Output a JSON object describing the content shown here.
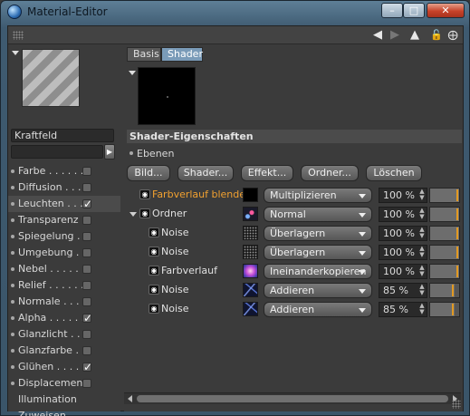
{
  "window": {
    "title": "Material-Editor"
  },
  "left": {
    "material_name": "Kraftfeld",
    "channels": [
      {
        "label": "Farbe . . . . . .",
        "checked": false,
        "has_checkbox": true
      },
      {
        "label": "Diffusion . . . .",
        "checked": false,
        "has_checkbox": true
      },
      {
        "label": "Leuchten . . . .",
        "checked": true,
        "has_checkbox": true,
        "active": true
      },
      {
        "label": "Transparenz",
        "checked": false,
        "has_checkbox": true
      },
      {
        "label": "Spiegelung . .",
        "checked": false,
        "has_checkbox": true
      },
      {
        "label": "Umgebung . .",
        "checked": false,
        "has_checkbox": true
      },
      {
        "label": "Nebel . . . . . .",
        "checked": false,
        "has_checkbox": true
      },
      {
        "label": "Relief . . . . . .",
        "checked": false,
        "has_checkbox": true
      },
      {
        "label": "Normale . . . .",
        "checked": false,
        "has_checkbox": true
      },
      {
        "label": "Alpha . . . . . .",
        "checked": true,
        "has_checkbox": true
      },
      {
        "label": "Glanzlicht . . .",
        "checked": false,
        "has_checkbox": true
      },
      {
        "label": "Glanzfarbe . .",
        "checked": false,
        "has_checkbox": true
      },
      {
        "label": "Glühen . . . . .",
        "checked": true,
        "has_checkbox": true
      },
      {
        "label": "Displacement",
        "checked": false,
        "has_checkbox": true
      },
      {
        "label": "Illumination",
        "has_checkbox": false
      },
      {
        "label": "Zuweisen",
        "has_checkbox": false
      }
    ]
  },
  "right": {
    "tabs": [
      "Basis",
      "Shader"
    ],
    "section_title": "Shader-Eigenschaften",
    "ebenen_label": "Ebenen",
    "buttons": [
      "Bild...",
      "Shader...",
      "Effekt...",
      "Ordner...",
      "Löschen"
    ],
    "layers": [
      {
        "name": "Farbverlauf blende",
        "mode": "Multiplizieren",
        "percent": "100 %",
        "level": 1.0,
        "indent": 0,
        "highlight": true,
        "thumb": "black"
      },
      {
        "name": "Ordner",
        "mode": "Normal",
        "percent": "100 %",
        "level": 1.0,
        "indent": 0,
        "folder": true,
        "thumb": "ordner"
      },
      {
        "name": "Noise",
        "mode": "Überlagern",
        "percent": "100 %",
        "level": 1.0,
        "indent": 1,
        "thumb": "noise"
      },
      {
        "name": "Noise",
        "mode": "Überlagern",
        "percent": "100 %",
        "level": 1.0,
        "indent": 1,
        "thumb": "noise"
      },
      {
        "name": "Farbverlauf",
        "mode": "Ineinanderkopieren",
        "percent": "100 %",
        "level": 1.0,
        "indent": 1,
        "thumb": "grad"
      },
      {
        "name": "Noise",
        "mode": "Addieren",
        "percent": "85 %",
        "level": 0.85,
        "indent": 1,
        "thumb": "noise2"
      },
      {
        "name": "Noise",
        "mode": "Addieren",
        "percent": "85 %",
        "level": 0.85,
        "indent": 1,
        "thumb": "noise2"
      }
    ]
  },
  "icons": {
    "toolbar": [
      "arrow-left-icon",
      "arrow-right-icon",
      "arrow-up-icon",
      "lock-icon",
      "new-window-icon"
    ]
  },
  "colors": {
    "highlight_text": "#f0a030",
    "active_tab": "#7a9bb8",
    "slider_marker": "#e39a22"
  }
}
